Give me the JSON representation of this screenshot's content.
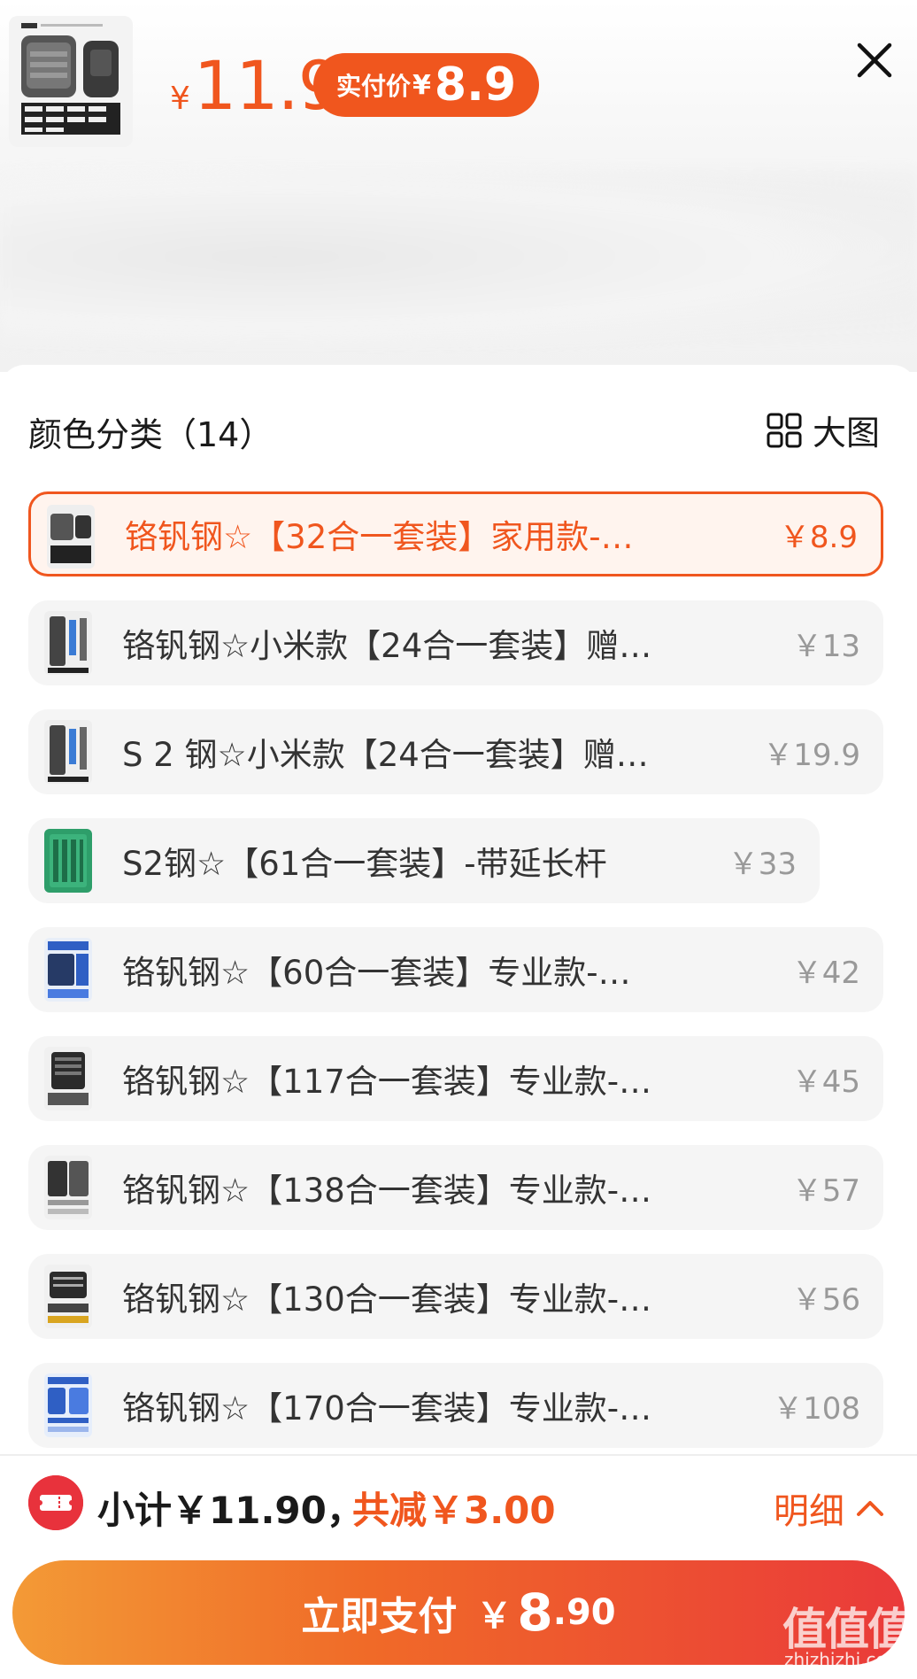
{
  "header": {
    "price_currency": "¥",
    "price_value": "11.9",
    "actual_label": "实付价",
    "actual_currency": "¥",
    "actual_value": "8.9",
    "close_icon": "close-icon"
  },
  "section": {
    "title": "颜色分类（14）",
    "big_image_label": "大图",
    "big_image_icon": "grid-icon"
  },
  "options": [
    {
      "name": "铬钒钢☆【32合一套装】家用款-…",
      "price": "￥8.9",
      "selected": true
    },
    {
      "name": "铬钒钢☆小米款【24合一套装】赠…",
      "price": "￥13",
      "selected": false
    },
    {
      "name": "S 2 钢☆小米款【24合一套装】赠…",
      "price": "￥19.9",
      "selected": false
    },
    {
      "name": "S2钢☆【61合一套装】-带延长杆",
      "price": "￥33",
      "selected": false
    },
    {
      "name": "铬钒钢☆【60合一套装】专业款-…",
      "price": "￥42",
      "selected": false
    },
    {
      "name": "铬钒钢☆【117合一套装】专业款-…",
      "price": "￥45",
      "selected": false
    },
    {
      "name": "铬钒钢☆【138合一套装】专业款-…",
      "price": "￥57",
      "selected": false
    },
    {
      "name": "铬钒钢☆【130合一套装】专业款-…",
      "price": "￥56",
      "selected": false
    },
    {
      "name": "铬钒钢☆【170合一套装】专业款-…",
      "price": "￥108",
      "selected": false
    }
  ],
  "footer": {
    "subtotal": "小计￥11.90，",
    "reduce": "共减￥3.00",
    "detail_label": "明细",
    "pay_label": "立即支付",
    "pay_currency": "￥",
    "pay_big": "8",
    "pay_small": ".90"
  },
  "watermark": {
    "text": "值值值",
    "sub": "zhizhizhi.com"
  },
  "colors": {
    "accent": "#f0561e",
    "coupon": "#e8323c"
  }
}
